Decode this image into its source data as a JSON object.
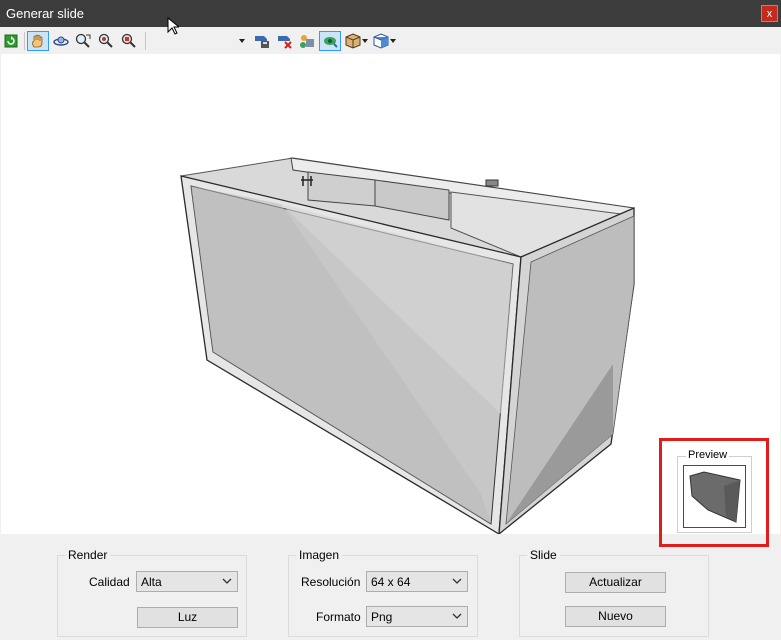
{
  "window": {
    "title": "Generar slide",
    "close_label": "x"
  },
  "toolbar": {
    "icons": [
      "refresh-icon",
      "pan-hand-icon",
      "orbit-icon",
      "zoom-window-icon",
      "zoom-in-icon",
      "zoom-extents-icon",
      "dropdown-arrow",
      "camera-save-icon",
      "camera-delete-icon",
      "materials-icon",
      "view-toggle-icon",
      "box-view-icon",
      "cube-view-icon"
    ]
  },
  "preview": {
    "legend": "Preview"
  },
  "render": {
    "legend": "Render",
    "quality_label": "Calidad",
    "quality_value": "Alta",
    "light_button": "Luz"
  },
  "image": {
    "legend": "Imagen",
    "resolution_label": "Resolución",
    "resolution_value": "64 x 64",
    "format_label": "Formato",
    "format_value": "Png"
  },
  "slide": {
    "legend": "Slide",
    "update_button": "Actualizar",
    "new_button": "Nuevo"
  },
  "colors": {
    "accent_highlight": "#e21c1c",
    "titlebar": "#3c3c3c",
    "close": "#c42b1c"
  }
}
